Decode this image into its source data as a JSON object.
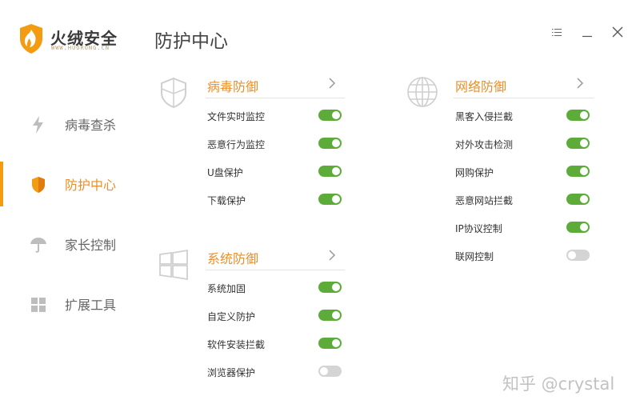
{
  "app": {
    "name": "火绒安全",
    "subtitle": "WWW.HUORONG.CN",
    "page_title": "防护中心"
  },
  "window_controls": {
    "menu_icon": "menu-icon",
    "minimize_icon": "minimize-icon",
    "close_icon": "close-icon"
  },
  "colors": {
    "accent": "#e8902c",
    "toggle_on": "#5dac3a",
    "toggle_off": "#d4d4d4",
    "active_bar": "#f39c12"
  },
  "sidebar": {
    "items": [
      {
        "label": "病毒查杀",
        "icon": "lightning-icon",
        "active": false
      },
      {
        "label": "防护中心",
        "icon": "shield-icon",
        "active": true
      },
      {
        "label": "家长控制",
        "icon": "umbrella-icon",
        "active": false
      },
      {
        "label": "扩展工具",
        "icon": "grid-icon",
        "active": false
      }
    ]
  },
  "sections": {
    "virus": {
      "title": "病毒防御",
      "icon": "shield-outline-icon",
      "items": [
        {
          "label": "文件实时监控",
          "enabled": true
        },
        {
          "label": "恶意行为监控",
          "enabled": true
        },
        {
          "label": "U盘保护",
          "enabled": true
        },
        {
          "label": "下载保护",
          "enabled": true
        }
      ]
    },
    "system": {
      "title": "系统防御",
      "icon": "windows-icon",
      "items": [
        {
          "label": "系统加固",
          "enabled": true
        },
        {
          "label": "自定义防护",
          "enabled": true
        },
        {
          "label": "软件安装拦截",
          "enabled": true
        },
        {
          "label": "浏览器保护",
          "enabled": false
        }
      ]
    },
    "network": {
      "title": "网络防御",
      "icon": "globe-icon",
      "items": [
        {
          "label": "黑客入侵拦截",
          "enabled": true
        },
        {
          "label": "对外攻击检测",
          "enabled": true
        },
        {
          "label": "网购保护",
          "enabled": true
        },
        {
          "label": "恶意网站拦截",
          "enabled": true
        },
        {
          "label": "IP协议控制",
          "enabled": true
        },
        {
          "label": "联网控制",
          "enabled": false
        }
      ]
    }
  },
  "watermark": "知乎 @crystal"
}
